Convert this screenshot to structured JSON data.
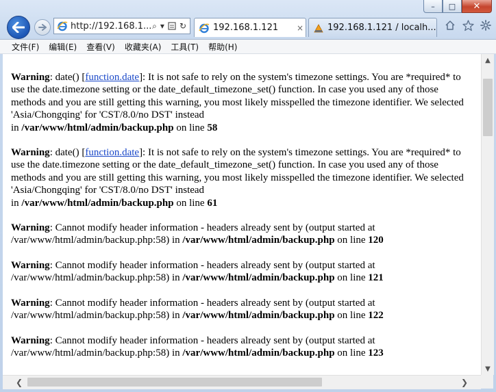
{
  "window": {
    "controls": {
      "minimize": "–",
      "maximize": "□",
      "close": "✕"
    }
  },
  "nav": {
    "address_text": "http://192.168.1....",
    "search_glyph": "⌕",
    "dropdown_glyph": "▾",
    "refresh_glyph": "↻",
    "tabs": [
      {
        "label": "192.168.1.121",
        "close": "×",
        "active": true
      },
      {
        "label": "192.168.1.121 / localh...",
        "active": false
      }
    ],
    "right_icons": [
      "home-icon",
      "star-icon",
      "gear-icon"
    ]
  },
  "menu": {
    "items": [
      "文件(F)",
      "编辑(E)",
      "查看(V)",
      "收藏夹(A)",
      "工具(T)",
      "帮助(H)"
    ]
  },
  "content": {
    "messages": [
      {
        "label": "Warning",
        "pre": ": date() [",
        "link": "function.date",
        "post": "]: It is not safe to rely on the system's timezone settings. You are *required* to use the date.timezone setting or the date_default_timezone_set() function. In case you used any of those methods and you are still getting this warning, you most likely misspelled the timezone identifier. We selected 'Asia/Chongqing' for 'CST/8.0/no DST' instead",
        "in_text": "in",
        "file": "/var/www/html/admin/backup.php",
        "line_text": "on line",
        "line": "58"
      },
      {
        "label": "Warning",
        "pre": ": date() [",
        "link": "function.date",
        "post": "]: It is not safe to rely on the system's timezone settings. You are *required* to use the date.timezone setting or the date_default_timezone_set() function. In case you used any of those methods and you are still getting this warning, you most likely misspelled the timezone identifier. We selected 'Asia/Chongqing' for 'CST/8.0/no DST' instead",
        "in_text": "in",
        "file": "/var/www/html/admin/backup.php",
        "line_text": "on line",
        "line": "61"
      },
      {
        "label": "Warning",
        "text": ": Cannot modify header information - headers already sent by (output started at /var/www/html/admin/backup.php:58) in",
        "file": "/var/www/html/admin/backup.php",
        "line_text": "on line",
        "line": "120"
      },
      {
        "label": "Warning",
        "text": ": Cannot modify header information - headers already sent by (output started at /var/www/html/admin/backup.php:58) in",
        "file": "/var/www/html/admin/backup.php",
        "line_text": "on line",
        "line": "121"
      },
      {
        "label": "Warning",
        "text": ": Cannot modify header information - headers already sent by (output started at /var/www/html/admin/backup.php:58) in",
        "file": "/var/www/html/admin/backup.php",
        "line_text": "on line",
        "line": "122"
      },
      {
        "label": "Warning",
        "text": ": Cannot modify header information - headers already sent by (output started at /var/www/html/admin/backup.php:58) in",
        "file": "/var/www/html/admin/backup.php",
        "line_text": "on line",
        "line": "123"
      }
    ]
  },
  "scrollbars": {
    "up": "▲",
    "down": "▼",
    "left": "❮",
    "right": "❯"
  }
}
